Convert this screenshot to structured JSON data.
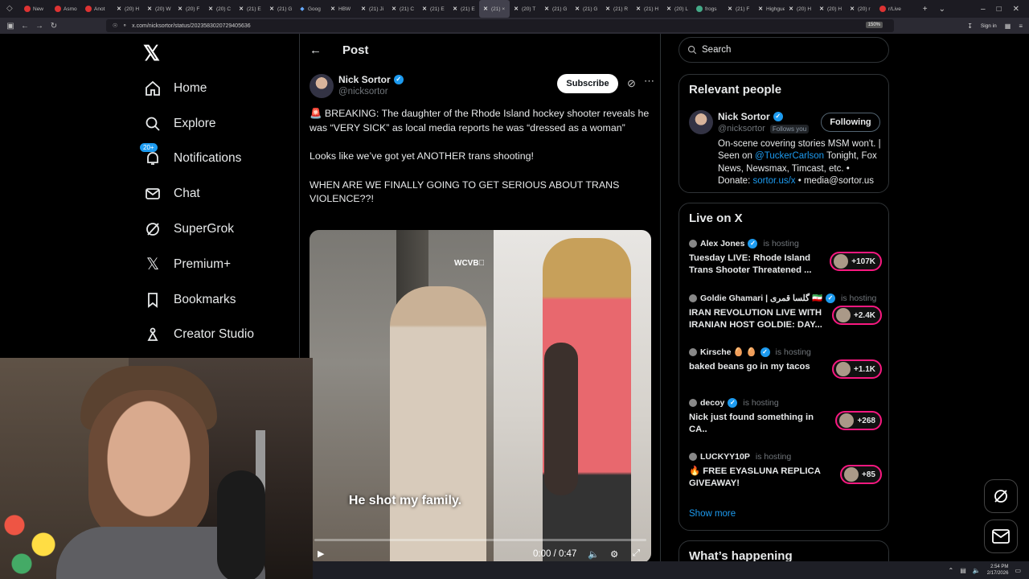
{
  "browser": {
    "tabs": [
      {
        "label": "New",
        "icon": "red"
      },
      {
        "label": "Asmo",
        "icon": "red"
      },
      {
        "label": "Anot",
        "icon": "red"
      },
      {
        "label": "(20) H",
        "icon": "x"
      },
      {
        "label": "(20) W",
        "icon": "x"
      },
      {
        "label": "(20) F",
        "icon": "x"
      },
      {
        "label": "(20) C",
        "icon": "x"
      },
      {
        "label": "(21) E",
        "icon": "x"
      },
      {
        "label": "(21) G",
        "icon": "x"
      },
      {
        "label": "Goog",
        "icon": "blue"
      },
      {
        "label": "HBW",
        "icon": "x"
      },
      {
        "label": "(21) Ji",
        "icon": "x"
      },
      {
        "label": "(21) C",
        "icon": "x"
      },
      {
        "label": "(21) E",
        "icon": "x"
      },
      {
        "label": "(21) E",
        "icon": "x"
      },
      {
        "label": "(21) ×",
        "icon": "x"
      },
      {
        "label": "(20) T",
        "icon": "x"
      },
      {
        "label": "(21) G",
        "icon": "x"
      },
      {
        "label": "(21) G",
        "icon": "x"
      },
      {
        "label": "(21) R",
        "icon": "x"
      },
      {
        "label": "(21) H",
        "icon": "x"
      },
      {
        "label": "(20) L",
        "icon": "x"
      },
      {
        "label": "frogs",
        "icon": "g"
      },
      {
        "label": "(21) F",
        "icon": "x"
      },
      {
        "label": "Highgue",
        "icon": "x"
      },
      {
        "label": "(20) H",
        "icon": "x"
      },
      {
        "label": "(20) H",
        "icon": "x"
      },
      {
        "label": "(20) r",
        "icon": "x"
      },
      {
        "label": "r/Live",
        "icon": "red"
      }
    ],
    "url": "x.com/nicksortor/status/2023583020729405636",
    "zoom": "150%",
    "sign_in": "Sign in"
  },
  "nav": {
    "items": [
      {
        "label": "Home",
        "icon": "home-icon"
      },
      {
        "label": "Explore",
        "icon": "search-icon"
      },
      {
        "label": "Notifications",
        "icon": "bell-icon",
        "badge": "20+"
      },
      {
        "label": "Chat",
        "icon": "mail-icon"
      },
      {
        "label": "SuperGrok",
        "icon": "grok-icon"
      },
      {
        "label": "Premium+",
        "icon": "x-icon"
      },
      {
        "label": "Bookmarks",
        "icon": "bookmark-icon"
      },
      {
        "label": "Creator Studio",
        "icon": "creator-icon"
      }
    ]
  },
  "post": {
    "header": "Post",
    "author_name": "Nick Sortor",
    "author_handle": "@nicksortor",
    "subscribe_label": "Subscribe",
    "text_p1": "🚨 BREAKING: The daughter of the Rhode Island hockey shooter reveals he was “VERY SICK” as local media reports he was “dressed as a woman”",
    "text_p2": "Looks like we’ve got yet ANOTHER trans shooting!",
    "text_p3": "WHEN ARE WE FINALLY GOING TO GET SERIOUS ABOUT TRANS VIOLENCE??!",
    "video": {
      "watermark": "WCVB⃝",
      "caption": "He shot my family.",
      "time": "0:00 / 0:47",
      "progress": 0.0
    }
  },
  "search": {
    "placeholder": "Search"
  },
  "relevant": {
    "title": "Relevant people",
    "name": "Nick Sortor",
    "handle": "@nicksortor",
    "follows_you": "Follows you",
    "follow_label": "Following",
    "bio_a": "On-scene covering stories MSM won't. | Seen on ",
    "bio_link1": "@TuckerCarlson",
    "bio_b": " Tonight, Fox News, Newsmax, Timcast, etc. • Donate: ",
    "bio_link2": "sortor.us/x",
    "bio_c": " • media@sortor.us"
  },
  "live": {
    "title": "Live on X",
    "host_suffix": "is hosting",
    "items": [
      {
        "host": "Alex Jones",
        "title": "Tuesday LIVE: Rhode Island Trans Shooter Threatened ...",
        "count": "+107K"
      },
      {
        "host": "Goldie Ghamari | گلسا قمری 🇮🇷",
        "title": "IRAN REVOLUTION LIVE WITH IRANIAN HOST GOLDIE: DAY...",
        "count": "+2.4K"
      },
      {
        "host": "Kirsche 🥚 🥚",
        "title": "baked beans go in my tacos",
        "count": "+1.1K"
      },
      {
        "host": "decoy",
        "title": "Nick just found something in CA..",
        "count": "+268"
      },
      {
        "host": "LUCKYY10P",
        "title": "🔥 FREE EYASLUNA REPLICA GIVEAWAY!",
        "count": "+85"
      }
    ],
    "show_more": "Show more"
  },
  "happening": {
    "title": "What’s happening"
  },
  "taskbar": {
    "time": "2:54 PM",
    "date": "2/17/2026"
  }
}
